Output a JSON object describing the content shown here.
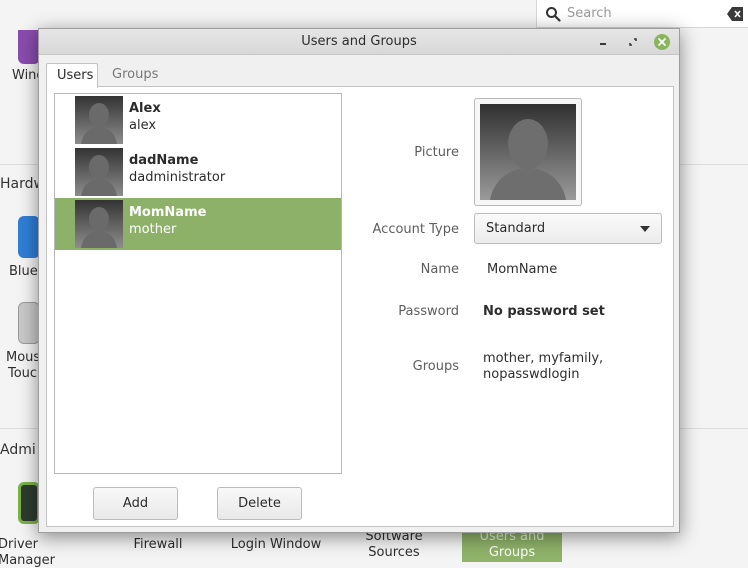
{
  "background": {
    "search": {
      "placeholder": "Search"
    },
    "sections": {
      "hardware": "Hardw",
      "administration": "Admi"
    },
    "labels": {
      "window": "Windo",
      "bluetooth": "Blue",
      "mouse_line1": "Mous",
      "mouse_line2": "Touc",
      "driver_manager": "Driver Manager",
      "firewall": "Firewall",
      "login_window": "Login Window",
      "software_sources_line1": "Software",
      "software_sources_line2": "Sources",
      "users_groups_line1": "Users and",
      "users_groups_line2": "Groups"
    }
  },
  "dialog": {
    "title": "Users and Groups",
    "tabs": [
      {
        "label": "Users"
      },
      {
        "label": "Groups"
      }
    ],
    "users": [
      {
        "name": "Alex",
        "username": "alex"
      },
      {
        "name": "dadName",
        "username": "dadministrator"
      },
      {
        "name": "MomName",
        "username": "mother"
      }
    ],
    "buttons": {
      "add": "Add",
      "delete": "Delete"
    },
    "details": {
      "picture_label": "Picture",
      "account_type_label": "Account Type",
      "account_type_value": "Standard",
      "name_label": "Name",
      "name_value": "MomName",
      "password_label": "Password",
      "password_value": "No password set",
      "groups_label": "Groups",
      "groups_value_line1": "mother, myfamily,",
      "groups_value_line2": "nopasswdlogin"
    }
  },
  "colors": {
    "selection": "#8db169",
    "close_button": "#8ab55c"
  }
}
